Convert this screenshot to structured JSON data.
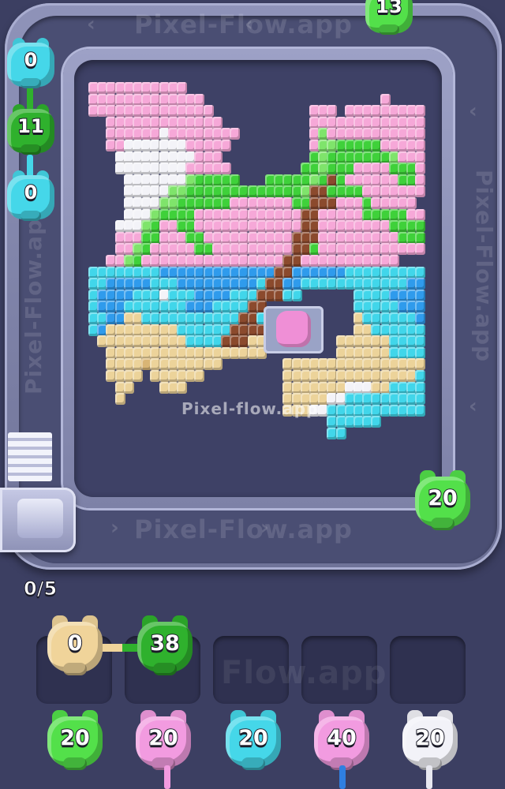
{
  "watermark": {
    "main": "Pixel-flow.app",
    "top": "Pixel-Flow.app",
    "bottom": "Pixel-Flow.app",
    "slots": "Flow.app"
  },
  "queue_counter": "0/5",
  "colors": {
    "pink": "#f6a8d8",
    "white": "#f3f3f8",
    "green_light": "#7fe46b",
    "green": "#3fd13a",
    "green_dark": "#24a522",
    "cyan": "#41d6ea",
    "blue": "#2f9bec",
    "brown": "#8b4a2d",
    "sand": "#ecd39a",
    "sand_dark": "#d9b574",
    "pig_pink": "#ef8fd6"
  },
  "conveyor_pigs": [
    {
      "count": "13",
      "color": "#53e04a"
    },
    {
      "count": "0",
      "color": "#45d7e9"
    },
    {
      "count": "11",
      "color": "#2fb12d"
    },
    {
      "count": "0",
      "color": "#45d7e9"
    },
    {
      "count": "20",
      "color": "#53e04a"
    }
  ],
  "holding_pigs": [
    {
      "count": "0",
      "color": "#f0d49a"
    },
    {
      "count": "38",
      "color": "#2fb12d"
    }
  ],
  "queue_pigs": [
    {
      "count": "20",
      "color": "#53e04a"
    },
    {
      "count": "20",
      "color": "#f29be0"
    },
    {
      "count": "20",
      "color": "#45d7e9"
    },
    {
      "count": "40",
      "color": "#f29be0"
    },
    {
      "count": "20",
      "color": "#f2f2f8"
    }
  ]
}
